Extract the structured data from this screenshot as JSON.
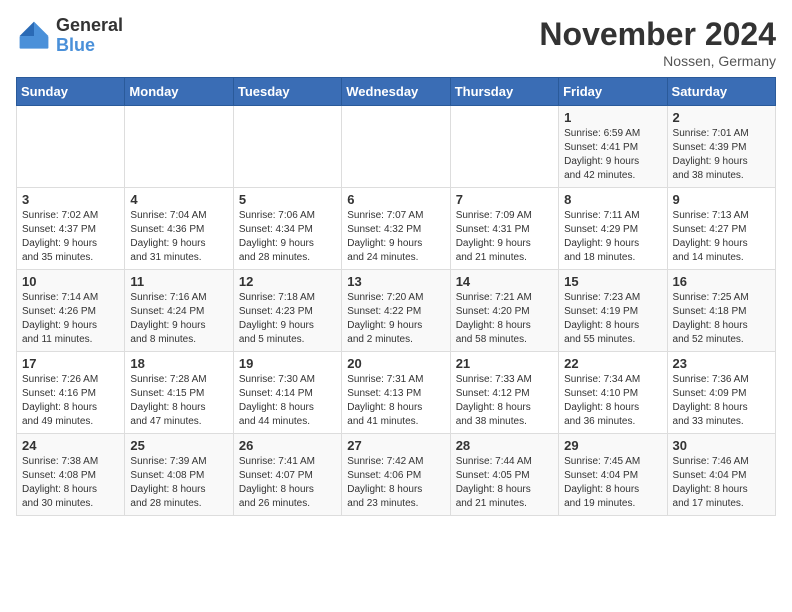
{
  "logo": {
    "general": "General",
    "blue": "Blue"
  },
  "header": {
    "month": "November 2024",
    "location": "Nossen, Germany"
  },
  "days_of_week": [
    "Sunday",
    "Monday",
    "Tuesday",
    "Wednesday",
    "Thursday",
    "Friday",
    "Saturday"
  ],
  "weeks": [
    [
      {
        "day": "",
        "info": ""
      },
      {
        "day": "",
        "info": ""
      },
      {
        "day": "",
        "info": ""
      },
      {
        "day": "",
        "info": ""
      },
      {
        "day": "",
        "info": ""
      },
      {
        "day": "1",
        "info": "Sunrise: 6:59 AM\nSunset: 4:41 PM\nDaylight: 9 hours\nand 42 minutes."
      },
      {
        "day": "2",
        "info": "Sunrise: 7:01 AM\nSunset: 4:39 PM\nDaylight: 9 hours\nand 38 minutes."
      }
    ],
    [
      {
        "day": "3",
        "info": "Sunrise: 7:02 AM\nSunset: 4:37 PM\nDaylight: 9 hours\nand 35 minutes."
      },
      {
        "day": "4",
        "info": "Sunrise: 7:04 AM\nSunset: 4:36 PM\nDaylight: 9 hours\nand 31 minutes."
      },
      {
        "day": "5",
        "info": "Sunrise: 7:06 AM\nSunset: 4:34 PM\nDaylight: 9 hours\nand 28 minutes."
      },
      {
        "day": "6",
        "info": "Sunrise: 7:07 AM\nSunset: 4:32 PM\nDaylight: 9 hours\nand 24 minutes."
      },
      {
        "day": "7",
        "info": "Sunrise: 7:09 AM\nSunset: 4:31 PM\nDaylight: 9 hours\nand 21 minutes."
      },
      {
        "day": "8",
        "info": "Sunrise: 7:11 AM\nSunset: 4:29 PM\nDaylight: 9 hours\nand 18 minutes."
      },
      {
        "day": "9",
        "info": "Sunrise: 7:13 AM\nSunset: 4:27 PM\nDaylight: 9 hours\nand 14 minutes."
      }
    ],
    [
      {
        "day": "10",
        "info": "Sunrise: 7:14 AM\nSunset: 4:26 PM\nDaylight: 9 hours\nand 11 minutes."
      },
      {
        "day": "11",
        "info": "Sunrise: 7:16 AM\nSunset: 4:24 PM\nDaylight: 9 hours\nand 8 minutes."
      },
      {
        "day": "12",
        "info": "Sunrise: 7:18 AM\nSunset: 4:23 PM\nDaylight: 9 hours\nand 5 minutes."
      },
      {
        "day": "13",
        "info": "Sunrise: 7:20 AM\nSunset: 4:22 PM\nDaylight: 9 hours\nand 2 minutes."
      },
      {
        "day": "14",
        "info": "Sunrise: 7:21 AM\nSunset: 4:20 PM\nDaylight: 8 hours\nand 58 minutes."
      },
      {
        "day": "15",
        "info": "Sunrise: 7:23 AM\nSunset: 4:19 PM\nDaylight: 8 hours\nand 55 minutes."
      },
      {
        "day": "16",
        "info": "Sunrise: 7:25 AM\nSunset: 4:18 PM\nDaylight: 8 hours\nand 52 minutes."
      }
    ],
    [
      {
        "day": "17",
        "info": "Sunrise: 7:26 AM\nSunset: 4:16 PM\nDaylight: 8 hours\nand 49 minutes."
      },
      {
        "day": "18",
        "info": "Sunrise: 7:28 AM\nSunset: 4:15 PM\nDaylight: 8 hours\nand 47 minutes."
      },
      {
        "day": "19",
        "info": "Sunrise: 7:30 AM\nSunset: 4:14 PM\nDaylight: 8 hours\nand 44 minutes."
      },
      {
        "day": "20",
        "info": "Sunrise: 7:31 AM\nSunset: 4:13 PM\nDaylight: 8 hours\nand 41 minutes."
      },
      {
        "day": "21",
        "info": "Sunrise: 7:33 AM\nSunset: 4:12 PM\nDaylight: 8 hours\nand 38 minutes."
      },
      {
        "day": "22",
        "info": "Sunrise: 7:34 AM\nSunset: 4:10 PM\nDaylight: 8 hours\nand 36 minutes."
      },
      {
        "day": "23",
        "info": "Sunrise: 7:36 AM\nSunset: 4:09 PM\nDaylight: 8 hours\nand 33 minutes."
      }
    ],
    [
      {
        "day": "24",
        "info": "Sunrise: 7:38 AM\nSunset: 4:08 PM\nDaylight: 8 hours\nand 30 minutes."
      },
      {
        "day": "25",
        "info": "Sunrise: 7:39 AM\nSunset: 4:08 PM\nDaylight: 8 hours\nand 28 minutes."
      },
      {
        "day": "26",
        "info": "Sunrise: 7:41 AM\nSunset: 4:07 PM\nDaylight: 8 hours\nand 26 minutes."
      },
      {
        "day": "27",
        "info": "Sunrise: 7:42 AM\nSunset: 4:06 PM\nDaylight: 8 hours\nand 23 minutes."
      },
      {
        "day": "28",
        "info": "Sunrise: 7:44 AM\nSunset: 4:05 PM\nDaylight: 8 hours\nand 21 minutes."
      },
      {
        "day": "29",
        "info": "Sunrise: 7:45 AM\nSunset: 4:04 PM\nDaylight: 8 hours\nand 19 minutes."
      },
      {
        "day": "30",
        "info": "Sunrise: 7:46 AM\nSunset: 4:04 PM\nDaylight: 8 hours\nand 17 minutes."
      }
    ]
  ]
}
